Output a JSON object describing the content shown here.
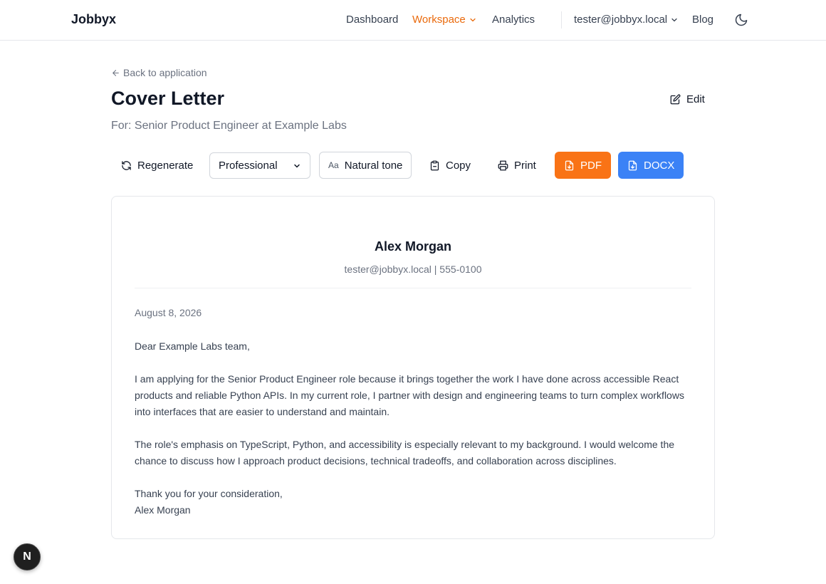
{
  "nav": {
    "brand": "Jobbyx",
    "links": [
      "Dashboard",
      "Workspace",
      "Analytics"
    ],
    "user": "tester@jobbyx.local",
    "blog": "Blog",
    "accent": "#ea6a0c"
  },
  "header": {
    "back": "Back to application",
    "title": "Cover Letter",
    "subtitle": "For: Senior Product Engineer at Example Labs",
    "edit": "Edit"
  },
  "toolbar": {
    "regenerate": "Regenerate",
    "tone_value": "Professional",
    "natural_tone": "Natural tone",
    "copy": "Copy",
    "print": "Print",
    "pdf": "PDF",
    "docx": "DOCX",
    "pdf_color": "#f97316",
    "docx_color": "#3b82f6"
  },
  "letter": {
    "name": "Alex Morgan",
    "contact": "tester@jobbyx.local | 555-0100",
    "date": "August 8, 2026",
    "greeting": "Dear Example Labs team,",
    "para1": "I am applying for the Senior Product Engineer role because it brings together the work I have done across accessible React products and reliable Python APIs. In my current role, I partner with design and engineering teams to turn complex workflows into interfaces that are easier to understand and maintain.",
    "para2": "The role's emphasis on TypeScript, Python, and accessibility is especially relevant to my background. I would welcome the chance to discuss how I approach product decisions, technical tradeoffs, and collaboration across disciplines.",
    "closing": "Thank you for your consideration,",
    "signature": "Alex Morgan"
  },
  "badge": {
    "letter": "N"
  }
}
